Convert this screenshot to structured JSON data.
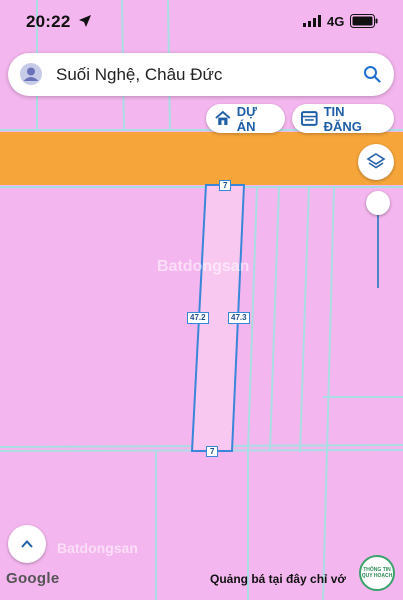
{
  "status_bar": {
    "time": "20:22",
    "network": "4G"
  },
  "search": {
    "query": "Suối Nghệ, Châu Đức"
  },
  "actions": {
    "project_label": "DỰ ÁN",
    "listing_label": "TIN ĐĂNG"
  },
  "parcel": {
    "top_edge": "7",
    "bottom_edge": "7",
    "left_edge": "47.2",
    "right_edge": "47.3"
  },
  "map": {
    "attribution": "Google",
    "watermark": "Batdongsan",
    "promo_text": "Quảng bá tại đây chỉ vớ",
    "badge_text": "THÔNG TIN QUY HOẠCH"
  },
  "colors": {
    "land_use_pink": "#f4b6ee",
    "road_orange": "#f6a53a",
    "parcel_outline": "#3a86d8",
    "parcel_lines": "#a9dde3",
    "accent_blue": "#1f5fa8"
  },
  "icons": {
    "location_arrow": "location-arrow-icon",
    "signal": "signal-icon",
    "battery": "battery-icon",
    "avatar": "account-icon",
    "search": "search-icon",
    "project": "house-icon",
    "listing": "listing-icon",
    "layers": "layers-icon",
    "up": "chevron-up-icon"
  }
}
